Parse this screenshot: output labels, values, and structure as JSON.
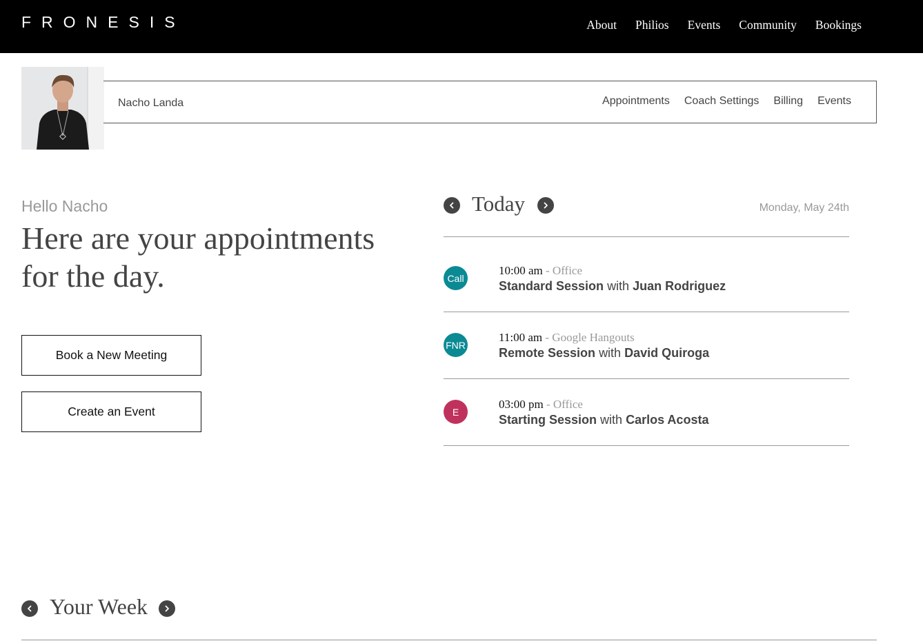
{
  "brand": {
    "logo": "FRONESIS"
  },
  "top_nav": [
    "About",
    "Philios",
    "Events",
    "Community",
    "Bookings"
  ],
  "profile": {
    "name": "Nacho Landa",
    "sub_nav": [
      "Appointments",
      "Coach Settings",
      "Billing",
      "Events"
    ]
  },
  "greeting": {
    "hello": "Hello Nacho",
    "headline": "Here are your appointments for the day."
  },
  "actions": {
    "book_label": "Book a New Meeting",
    "event_label": "Create an Event"
  },
  "today": {
    "title": "Today",
    "date": "Monday, May 24th",
    "appointments": [
      {
        "badge": "Call",
        "badge_color": "#0b8a94",
        "time": "10:00 am",
        "location": "Office",
        "session": "Standard Session",
        "connector": "with",
        "client": "Juan Rodriguez"
      },
      {
        "badge": "FNR",
        "badge_color": "#0b8a94",
        "time": "11:00 am",
        "location": "Google Hangouts",
        "session": "Remote Session",
        "connector": "with",
        "client": "David Quiroga"
      },
      {
        "badge": "E",
        "badge_color": "#c0325e",
        "time": "03:00 pm",
        "location": "Office",
        "session": "Starting Session",
        "connector": "with",
        "client": "Carlos Acosta"
      }
    ]
  },
  "week": {
    "title": "Your Week"
  },
  "icons": {
    "prev": "chevron-left-icon",
    "next": "chevron-right-icon"
  }
}
